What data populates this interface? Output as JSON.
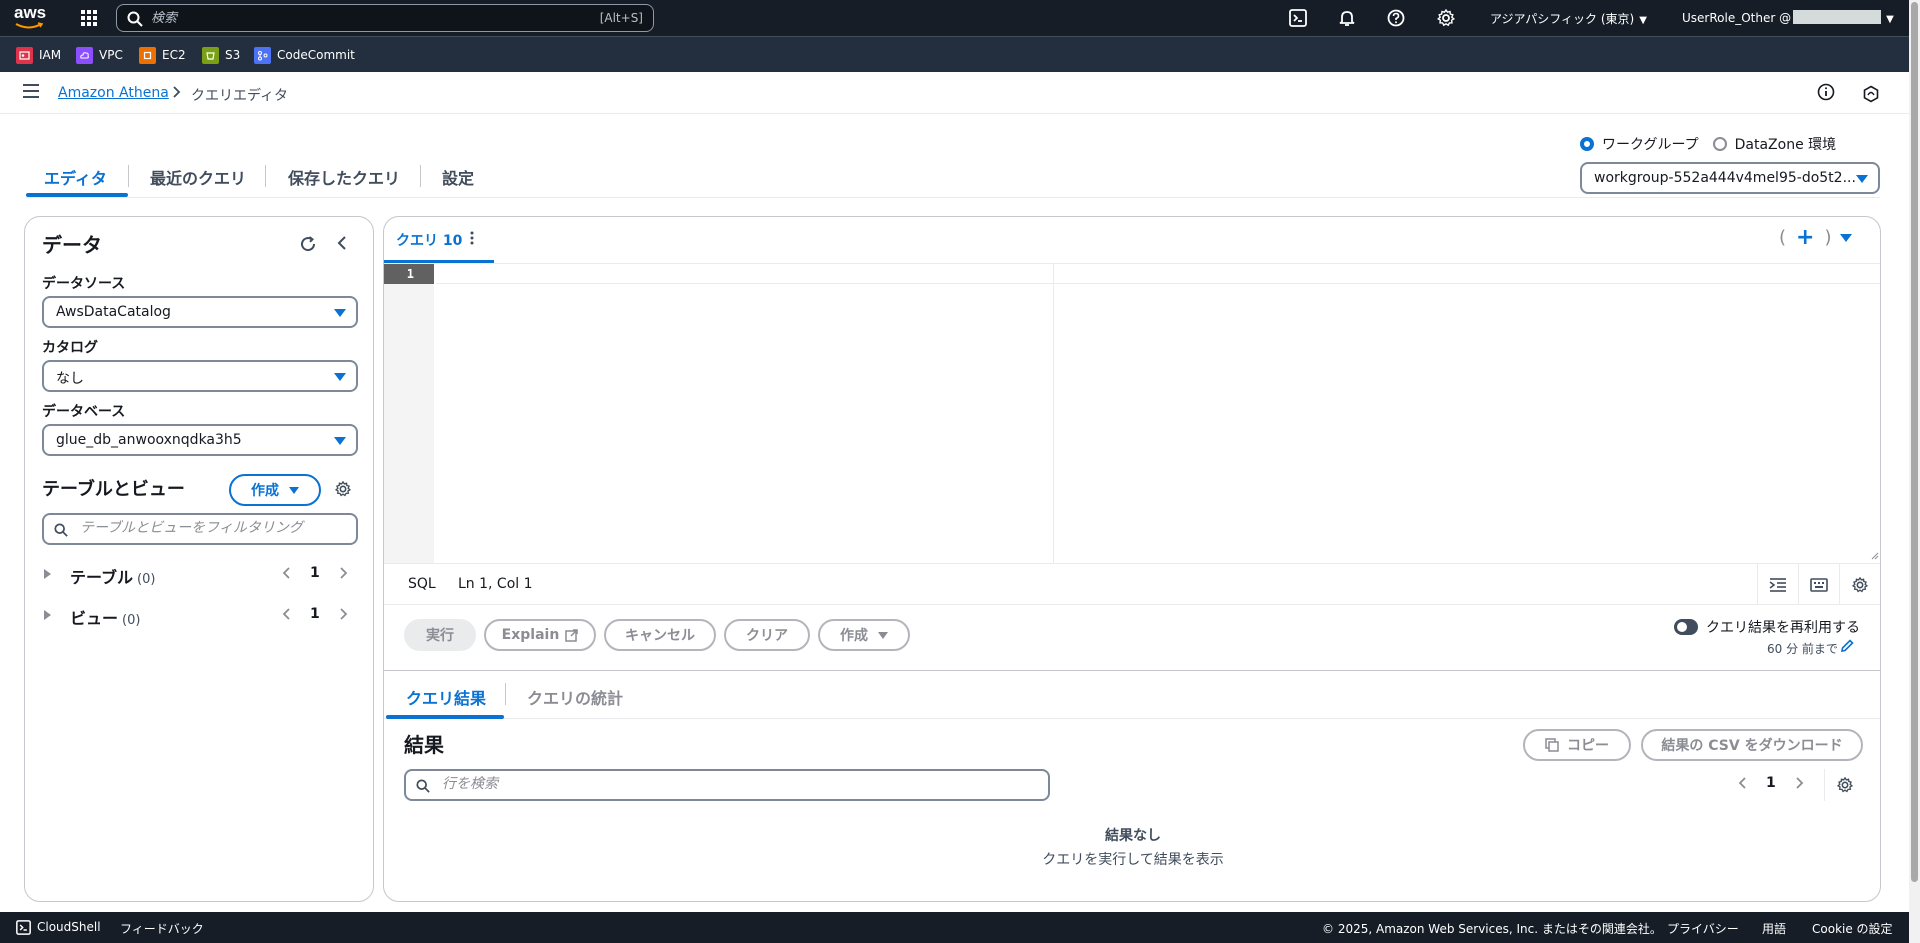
{
  "topnav": {
    "logo": "aws",
    "search_placeholder": "検索",
    "search_shortcut": "[Alt+S]",
    "region": "アジアパシフィック (東京)",
    "user": "UserRole_Other @",
    "icons": [
      "apps-grid-icon",
      "cloudshell-icon",
      "bell-icon",
      "help-icon",
      "gear-icon"
    ]
  },
  "favorites": [
    {
      "label": "IAM",
      "color": "#dd344c"
    },
    {
      "label": "VPC",
      "color": "#8c4fff"
    },
    {
      "label": "EC2",
      "color": "#ed7100"
    },
    {
      "label": "S3",
      "color": "#7aa116"
    },
    {
      "label": "CodeCommit",
      "color": "#4d72f3"
    }
  ],
  "breadcrumb": {
    "service": "Amazon Athena",
    "current": "クエリエディタ"
  },
  "tabs": [
    "エディタ",
    "最近のクエリ",
    "保存したクエリ",
    "設定"
  ],
  "env": {
    "radio_workgroup": "ワークグループ",
    "radio_datazone": "DataZone 環境",
    "workgroup_value": "workgroup-552a444v4mel95-do5t2..."
  },
  "data_panel": {
    "title": "データ",
    "datasource_label": "データソース",
    "datasource_value": "AwsDataCatalog",
    "catalog_label": "カタログ",
    "catalog_value": "なし",
    "database_label": "データベース",
    "database_value": "glue_db_anwooxnqdka3h5",
    "tables_views_title": "テーブルとビュー",
    "create_label": "作成",
    "filter_placeholder": "テーブルとビューをフィルタリング",
    "tables_label": "テーブル",
    "tables_count": "(0)",
    "tables_page": "1",
    "views_label": "ビュー",
    "views_count": "(0)",
    "views_page": "1"
  },
  "editor": {
    "query_tab": "クエリ 10",
    "line_number": "1",
    "language": "SQL",
    "cursor": "Ln 1, Col 1",
    "run_label": "実行",
    "explain_label": "Explain",
    "cancel_label": "キャンセル",
    "clear_label": "クリア",
    "create_label": "作成",
    "reuse_label": "クエリ結果を再利用する",
    "reuse_sub": "60 分 前まで"
  },
  "results": {
    "tab_results": "クエリ結果",
    "tab_stats": "クエリの統計",
    "title": "結果",
    "copy_label": "コピー",
    "download_label": "結果の CSV をダウンロード",
    "search_placeholder": "行を検索",
    "page": "1",
    "empty_title": "結果なし",
    "empty_sub": "クエリを実行して結果を表示"
  },
  "footer": {
    "cloudshell": "CloudShell",
    "feedback": "フィードバック",
    "copyright": "© 2025, Amazon Web Services, Inc. またはその関連会社。",
    "privacy": "プライバシー",
    "terms": "用語",
    "cookie": "Cookie の設定"
  },
  "colors": {
    "accent": "#0972d3",
    "nav_bg": "#161d26",
    "fav_bg": "#232f3e"
  }
}
